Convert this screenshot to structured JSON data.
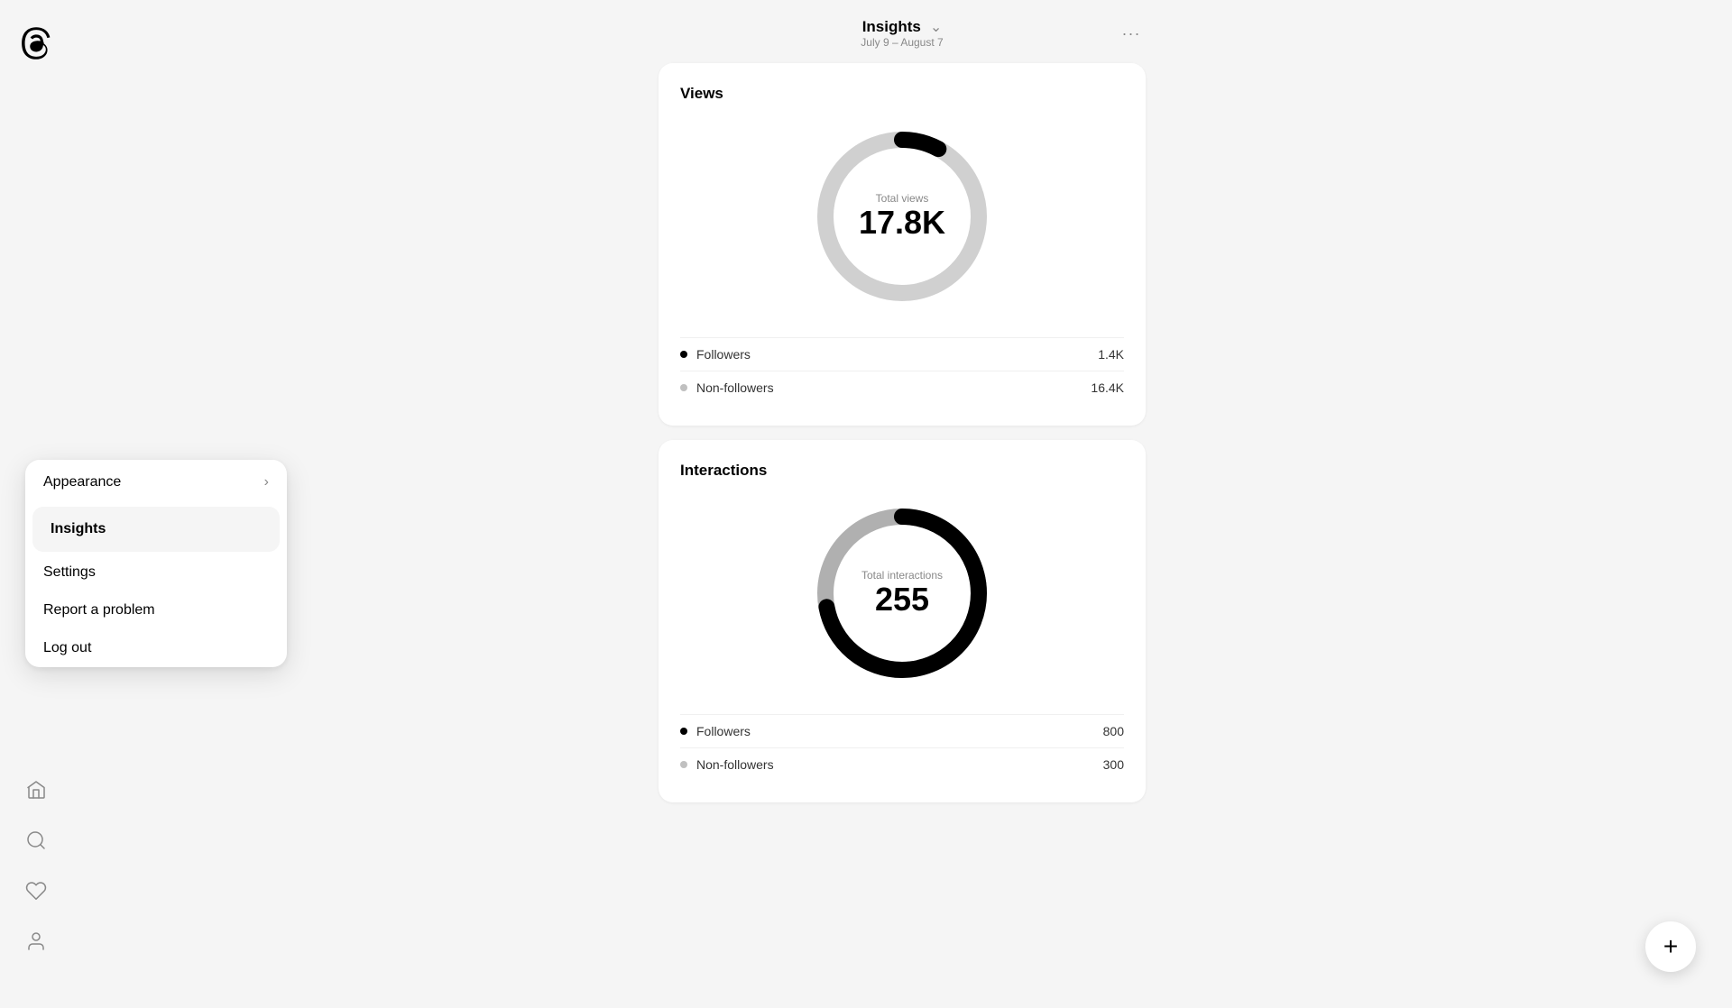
{
  "app": {
    "logo_label": "Threads logo"
  },
  "sidebar": {
    "icons": [
      {
        "name": "home-icon",
        "symbol": "home"
      },
      {
        "name": "search-icon",
        "symbol": "search"
      },
      {
        "name": "activity-icon",
        "symbol": "heart"
      },
      {
        "name": "profile-icon",
        "symbol": "user"
      }
    ]
  },
  "header": {
    "title": "Insights",
    "subtitle": "July 9 – August 7",
    "more_label": "···"
  },
  "views_card": {
    "title": "Views",
    "donut": {
      "label": "Total views",
      "value": "17.8K",
      "followers_percent": 7.9,
      "nonfollowers_percent": 92.1,
      "followers_color": "#000000",
      "nonfollowers_color": "#d0d0d0"
    },
    "legend": [
      {
        "label": "Followers",
        "value": "1.4K",
        "color": "#000000"
      },
      {
        "label": "Non-followers",
        "value": "16.4K",
        "color": "#c0c0c0"
      }
    ]
  },
  "interactions_card": {
    "title": "Interactions",
    "donut": {
      "label": "Total interactions",
      "value": "255",
      "followers_percent": 72,
      "nonfollowers_percent": 28,
      "followers_color": "#000000",
      "nonfollowers_color": "#b0b0b0"
    },
    "legend": [
      {
        "label": "Followers",
        "value": "800",
        "color": "#000000"
      },
      {
        "label": "Non-followers",
        "value": "300",
        "color": "#c0c0c0"
      }
    ]
  },
  "context_menu": {
    "items": [
      {
        "id": "appearance",
        "label": "Appearance",
        "has_chevron": true
      },
      {
        "id": "insights",
        "label": "Insights",
        "has_chevron": false
      },
      {
        "id": "settings",
        "label": "Settings",
        "has_chevron": false
      },
      {
        "id": "report",
        "label": "Report a problem",
        "has_chevron": false
      },
      {
        "id": "logout",
        "label": "Log out",
        "has_chevron": false
      }
    ]
  },
  "fab": {
    "label": "+"
  }
}
